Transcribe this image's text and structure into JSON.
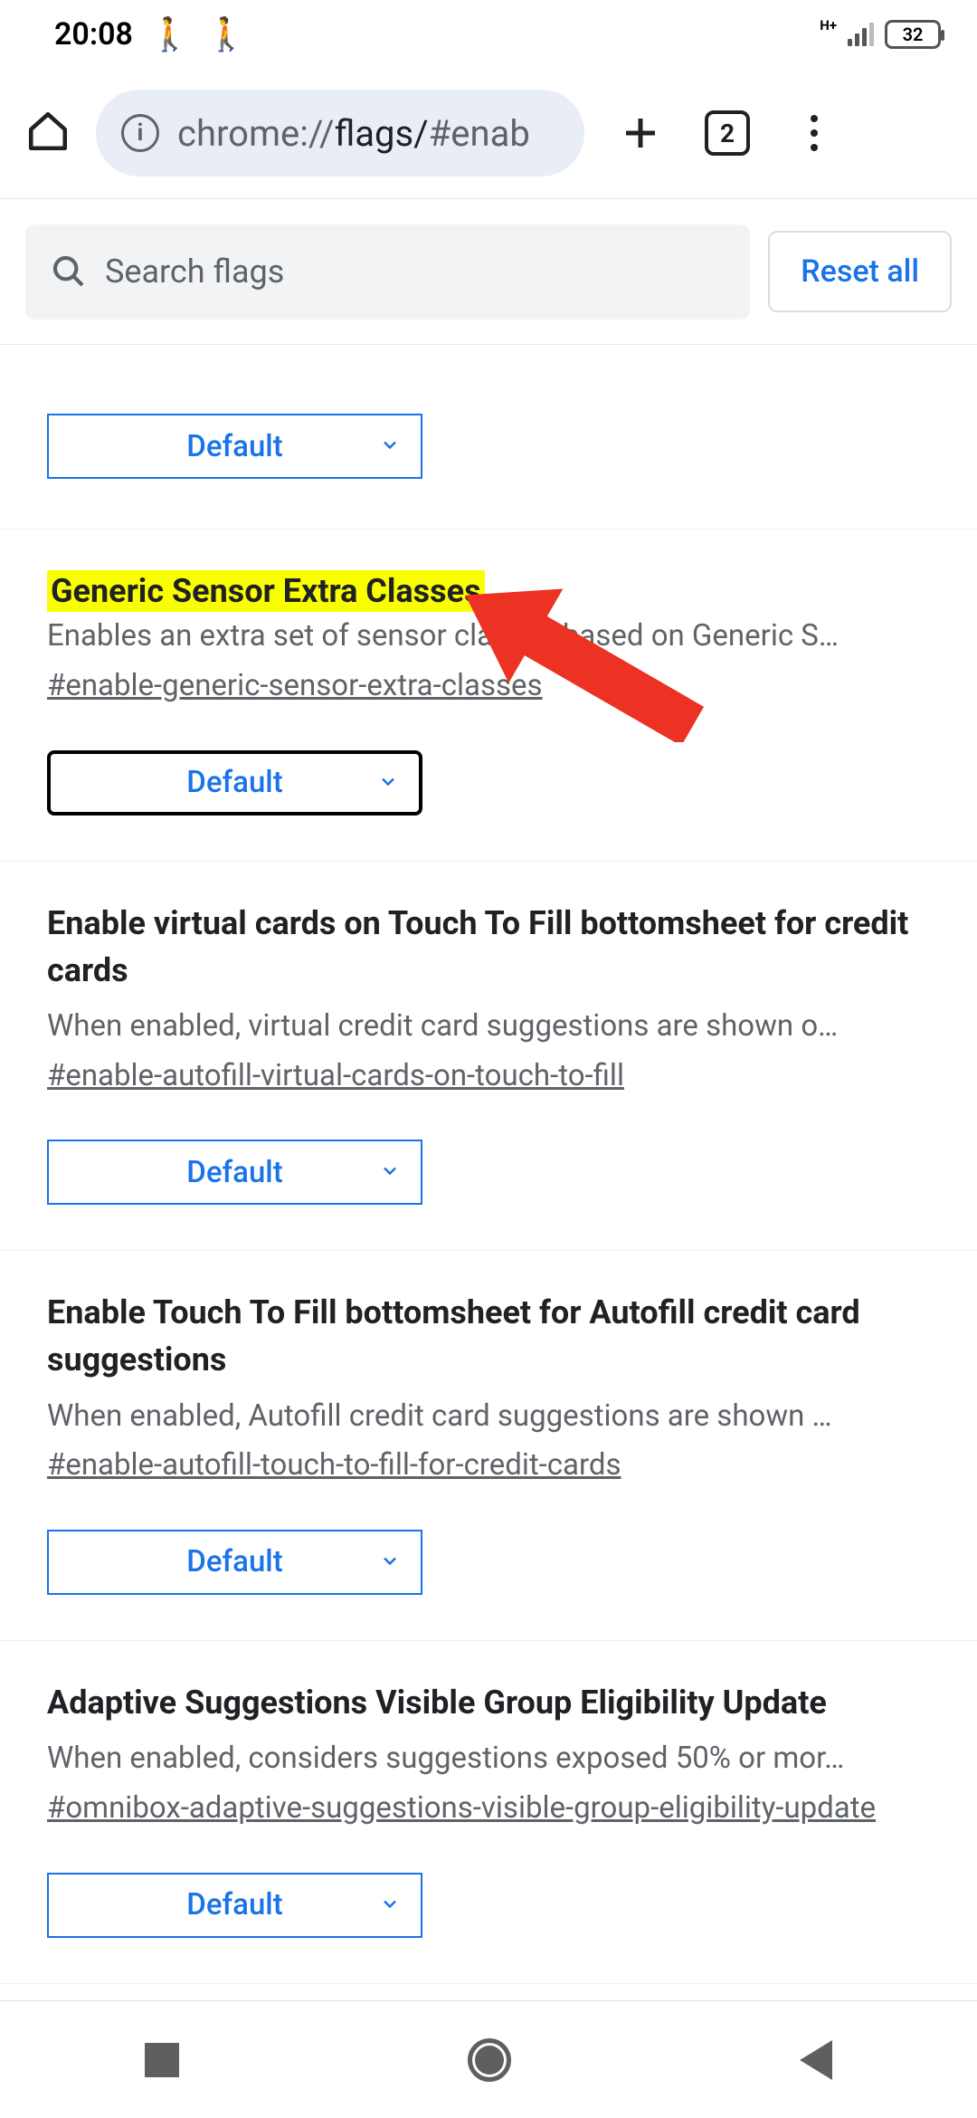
{
  "status_bar": {
    "time": "20:08",
    "network_type": "H+",
    "battery_percent": "32"
  },
  "browser": {
    "url_prefix": "chrome://",
    "url_path": "flags/",
    "url_fragment": "#enab",
    "tab_count": "2"
  },
  "search": {
    "placeholder": "Search flags",
    "reset_label": "Reset all"
  },
  "flags": [
    {
      "title": "Generic Sensor Extra Classes",
      "highlighted": true,
      "description": "Enables an extra set of sensor classes based on Generic S…",
      "hash": "#enable-generic-sensor-extra-classes",
      "value": "Default",
      "focused": true
    },
    {
      "title": "Enable virtual cards on Touch To Fill bottomsheet for credit cards",
      "highlighted": false,
      "description": "When enabled, virtual credit card suggestions are shown o…",
      "hash": "#enable-autofill-virtual-cards-on-touch-to-fill",
      "value": "Default",
      "focused": false
    },
    {
      "title": "Enable Touch To Fill bottomsheet for Autofill credit card suggestions",
      "highlighted": false,
      "description": "When enabled, Autofill credit card suggestions are shown …",
      "hash": "#enable-autofill-touch-to-fill-for-credit-cards",
      "value": "Default",
      "focused": false
    },
    {
      "title": "Adaptive Suggestions Visible Group Eligibility Update",
      "highlighted": false,
      "description": "When enabled, considers suggestions exposed 50% or mor…",
      "hash": "#omnibox-adaptive-suggestions-visible-group-eligibility-update",
      "value": "Default",
      "focused": false
    }
  ],
  "peek_select_value": "Default"
}
